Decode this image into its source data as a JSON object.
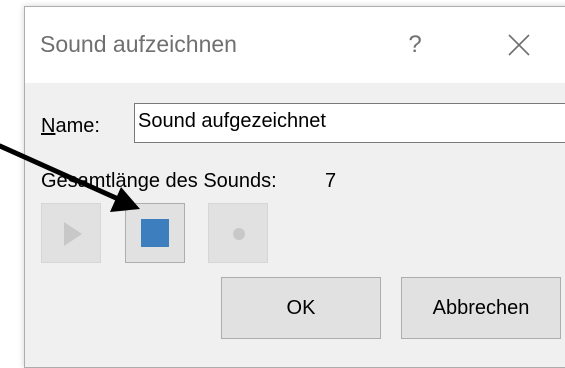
{
  "dialog": {
    "title": "Sound aufzeichnen",
    "help_glyph": "?",
    "name_label_mnemonic": "N",
    "name_label_rest": "ame:",
    "name_value": "Sound aufgezeichnet",
    "length_label": "Gesamtlänge des Sounds:",
    "length_value": "7",
    "play_icon": "play-icon",
    "stop_icon": "stop-icon",
    "record_icon": "record-icon",
    "ok_label": "OK",
    "cancel_label": "Abbrechen"
  },
  "colors": {
    "stop_square": "#3d7ebf",
    "disabled_glyph": "#c8c8c8",
    "title_text": "#707070",
    "arrow": "#000000"
  }
}
